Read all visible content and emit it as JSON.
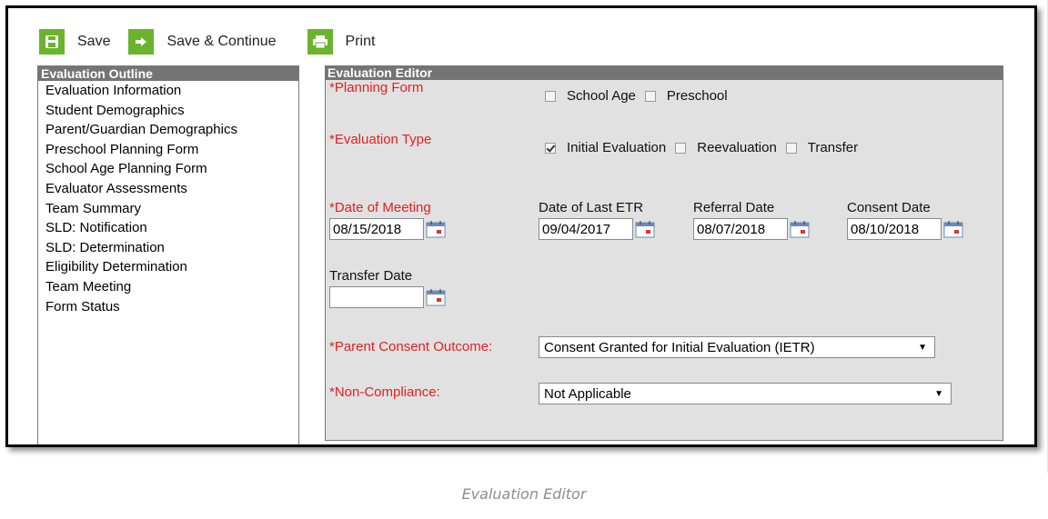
{
  "toolbar": {
    "save_label": "Save",
    "save_continue_label": "Save & Continue",
    "print_label": "Print"
  },
  "outline": {
    "title": "Evaluation Outline",
    "items": [
      "Evaluation Information",
      "Student Demographics",
      "Parent/Guardian Demographics",
      "Preschool Planning Form",
      "School Age Planning Form",
      "Evaluator Assessments",
      "Team Summary",
      "SLD: Notification",
      "SLD: Determination",
      "Eligibility Determination",
      "Team Meeting",
      "Form Status"
    ]
  },
  "editor": {
    "title": "Evaluation Editor",
    "planning_form": {
      "label": "*Planning Form",
      "options": [
        {
          "label": "School Age",
          "checked": false
        },
        {
          "label": "Preschool",
          "checked": false
        }
      ]
    },
    "evaluation_type": {
      "label": "*Evaluation Type",
      "options": [
        {
          "label": "Initial Evaluation",
          "checked": true
        },
        {
          "label": "Reevaluation",
          "checked": false
        },
        {
          "label": "Transfer",
          "checked": false
        }
      ]
    },
    "dates": {
      "meeting": {
        "label": "*Date of Meeting",
        "value": "08/15/2018"
      },
      "last_etr": {
        "label": "Date of Last ETR",
        "value": "09/04/2017"
      },
      "referral": {
        "label": "Referral Date",
        "value": "08/07/2018"
      },
      "consent": {
        "label": "Consent Date",
        "value": "08/10/2018"
      },
      "transfer": {
        "label": "Transfer Date",
        "value": ""
      }
    },
    "parent_consent": {
      "label": "*Parent Consent Outcome:",
      "value": "Consent Granted for Initial Evaluation (IETR)"
    },
    "non_compliance": {
      "label": "*Non-Compliance:",
      "value": "Not Applicable"
    }
  },
  "caption": "Evaluation Editor",
  "colors": {
    "toolbar_icon": "#6ab42d",
    "panel_header": "#747474",
    "editor_bg": "#e1e1e1",
    "required": "#e52020"
  }
}
